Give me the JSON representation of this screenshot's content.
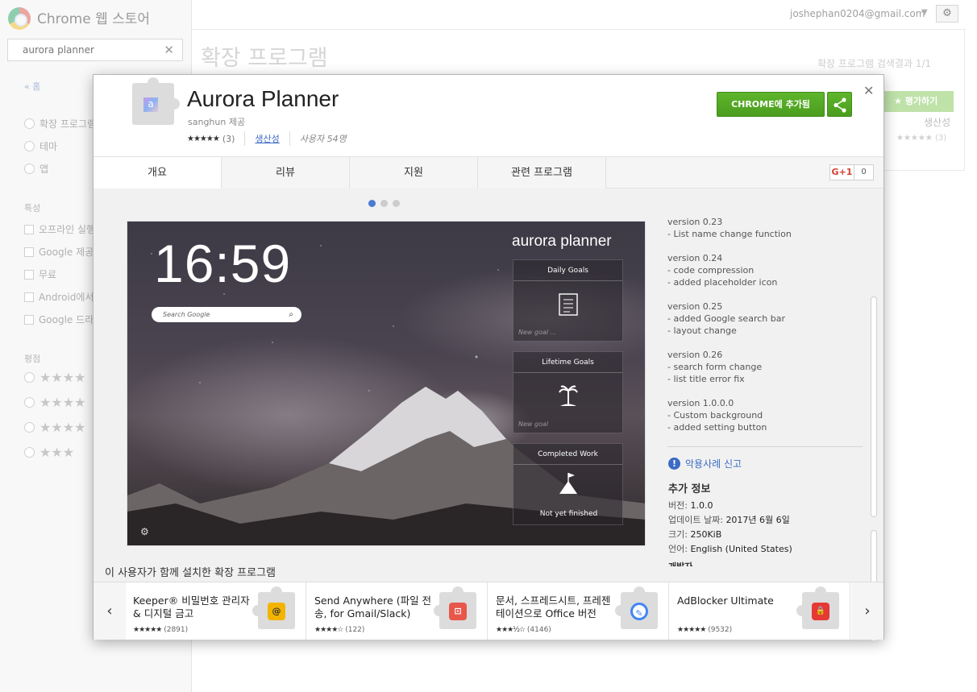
{
  "store": {
    "title": "Chrome 웹 스토어",
    "search_value": "aurora planner",
    "home_link": "« 홈",
    "categories": [
      "확장 프로그램",
      "테마",
      "앱"
    ],
    "features_label": "특성",
    "features": [
      "오프라인 실행",
      "Google 제공",
      "무료",
      "Android에서",
      "Google 드라이브"
    ],
    "ratings_label": "평점",
    "user_email": "joshephan0204@gmail.com",
    "page_title": "확장 프로그램",
    "results_text": "확장 프로그램 검색결과 1/1",
    "rate_button": "평가하기",
    "category_text": "생산성",
    "rating_count": "(3)"
  },
  "detail": {
    "app_title": "Aurora Planner",
    "developer": "sanghun 제공",
    "rating_count": "(3)",
    "category": "생산성",
    "users": "사용자 54명",
    "add_button": "CHROME에 추가됨",
    "tabs": [
      "개요",
      "리뷰",
      "지원",
      "관련 프로그램"
    ],
    "gplus_label": "G+1",
    "gplus_count": "0"
  },
  "preview": {
    "clock": "16:59",
    "search_placeholder": "Search Google",
    "brand": "aurora planner",
    "boxes": [
      {
        "title": "Daily Goals",
        "placeholder": "New goal ..."
      },
      {
        "title": "Lifetime Goals",
        "placeholder": "New goal"
      },
      {
        "title": "Completed Work",
        "status": "Not yet finished"
      }
    ]
  },
  "release_notes": [
    {
      "version": "version 0.23",
      "items": [
        "- List name change function"
      ]
    },
    {
      "version": "version 0.24",
      "items": [
        "- code compression",
        "- added placeholder icon"
      ]
    },
    {
      "version": "version 0.25",
      "items": [
        "- added Google search bar",
        "- layout change"
      ]
    },
    {
      "version": "version 0.26",
      "items": [
        "- search form change",
        "- list title error fix"
      ]
    },
    {
      "version": "version 1.0.0.0",
      "items": [
        "- Custom background",
        "- added setting button"
      ]
    }
  ],
  "info": {
    "report_link": "악용사례 신고",
    "title": "추가 정보",
    "version_label": "버전:",
    "version_value": "1.0.0",
    "updated_label": "업데이트 날짜:",
    "updated_value": "2017년 6월 6일",
    "size_label": "크기:",
    "size_value": "250KiB",
    "lang_label": "언어:",
    "lang_value": "English (United States)",
    "cut_heading": "개발자"
  },
  "also_installed_title": "이 사용자가 함께 설치한 확장 프로그램",
  "related": [
    {
      "name": "Keeper® 비밀번호 관리자 & 디지털 금고",
      "rating_count": "(2891)",
      "stars": "★★★★★",
      "icon_color": "#f2b400",
      "icon_glyph": "@"
    },
    {
      "name": "Send Anywhere (파일 전송, for Gmail/Slack)",
      "rating_count": "(122)",
      "stars": "★★★★☆",
      "icon_color": "#e8574b",
      "icon_glyph": "⊡"
    },
    {
      "name": "문서, 스프레드시트, 프레젠테이션으로 Office 버전",
      "rating_count": "(4146)",
      "stars": "★★★½☆",
      "icon_color": "#4285f4",
      "icon_glyph": "✎"
    },
    {
      "name": "AdBlocker Ultimate",
      "rating_count": "(9532)",
      "stars": "★★★★★",
      "icon_color": "#e53935",
      "icon_glyph": "🔒"
    }
  ],
  "colors": {
    "accent_green": "#4a9d1d",
    "link_blue": "#3b6bc4"
  }
}
